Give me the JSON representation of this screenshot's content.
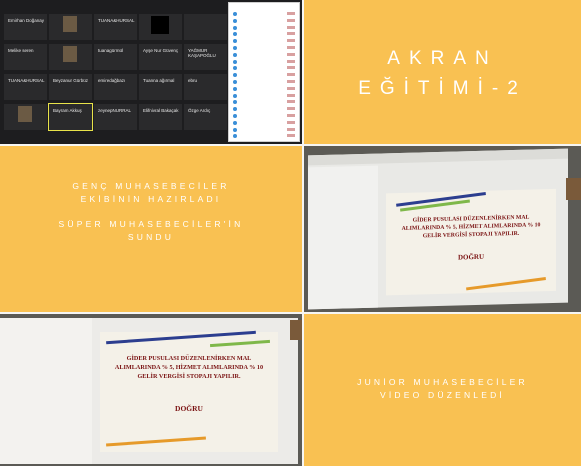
{
  "title": {
    "line1": "AKRAN",
    "line2": "EĞİTİMİ-2"
  },
  "credits": {
    "line1": "GENÇ MUHASEBECİLER",
    "line2": "EKİBİNİN HAZIRLADI",
    "line3": "SÜPER MUHASEBECİLER'İN",
    "line4": "SUNDU"
  },
  "junior": {
    "line1": "JUNİOR MUHASEBECİLER",
    "line2": "VİDEO DÜZENLEDİ"
  },
  "slide": {
    "question": "GİDER PUSULASI DÜZENLENİRKEN MAL ALIMLARINDA % 5, HİZMET ALIMLARINDA % 10 GELİR VERGİSİ STOPAJI YAPILIR.",
    "answer": "DOĞRU"
  },
  "zoom": {
    "tiles": [
      {
        "name": "Emirhan Doğanay",
        "sub": ""
      },
      {
        "name": "",
        "sub": ""
      },
      {
        "name": "TUANA&HURSAL",
        "sub": ""
      },
      {
        "name": "",
        "sub": ""
      },
      {
        "name": "",
        "sub": ""
      },
      {
        "name": "Melike seren",
        "sub": ""
      },
      {
        "name": "",
        "sub": ""
      },
      {
        "name": "tuanagürmül",
        "sub": ""
      },
      {
        "name": "Ayşe Nur Güvenç",
        "sub": ""
      },
      {
        "name": "YAĞMUR KAŞAPOĞLU",
        "sub": ""
      },
      {
        "name": "TUANA&HURSAL",
        "sub": ""
      },
      {
        "name": "Beyzanur Gürbüz",
        "sub": ""
      },
      {
        "name": "emiredağbazı",
        "sub": ""
      },
      {
        "name": "Tuanna ağırmal",
        "sub": ""
      },
      {
        "name": "ebru",
        "sub": ""
      },
      {
        "name": "",
        "sub": ""
      },
      {
        "name": "Bayram Akkuş",
        "sub": ""
      },
      {
        "name": "zeynepNURRAL",
        "sub": ""
      },
      {
        "name": "Elifnivral Bakaçak",
        "sub": ""
      },
      {
        "name": "Özge Ardıç",
        "sub": ""
      }
    ],
    "participants": [
      "",
      "",
      "",
      "",
      "",
      "",
      "",
      "",
      "",
      "",
      "",
      "",
      "",
      "",
      "",
      "",
      "",
      "",
      ""
    ]
  },
  "colors": {
    "orange": "#f9c152",
    "white": "#ffffff",
    "slide_text": "#7a1212",
    "stripe_blue": "#2c3e8f",
    "stripe_green": "#7fb84a",
    "stripe_orange": "#e69a2a"
  }
}
